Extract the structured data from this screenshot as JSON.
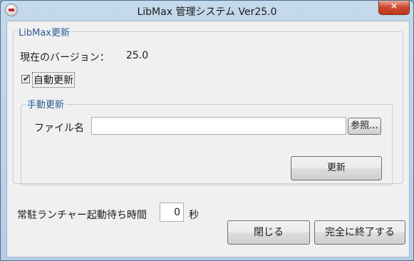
{
  "window": {
    "title": "LibMax 管理システム Ver25.0",
    "close_label": "✕"
  },
  "update_group": {
    "legend": "LibMax更新",
    "version_label": "現在のバージョン：",
    "version_value": "25.0",
    "auto_update_label": "自動更新",
    "auto_update_checked": true
  },
  "manual_group": {
    "legend": "手動更新",
    "file_label": "ファイル名",
    "file_value": "",
    "browse_label": "参照...",
    "update_label": "更新"
  },
  "launcher": {
    "wait_label": "常駐ランチャー起動待ち時間",
    "wait_value": "0",
    "unit_label": "秒"
  },
  "footer": {
    "close_label": "閉じる",
    "quit_label": "完全に終了する"
  }
}
